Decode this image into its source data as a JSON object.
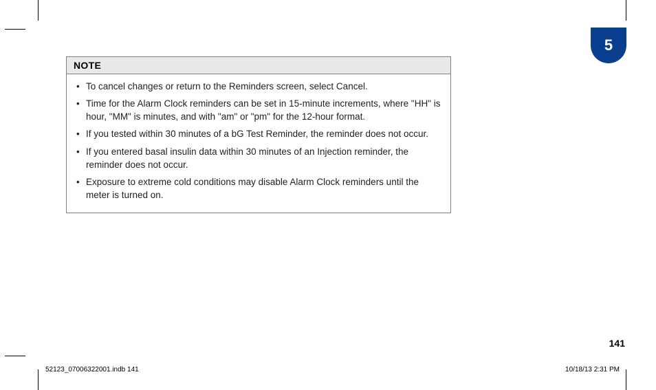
{
  "chapter": {
    "number": "5"
  },
  "note": {
    "heading": "NOTE",
    "items": [
      "To cancel changes or return to the Reminders screen, select Cancel.",
      "Time for the Alarm Clock reminders can be set in 15-minute increments, where \"HH\" is hour, \"MM\" is minutes, and with \"am\" or \"pm\" for the 12-hour format.",
      "If you tested within 30 minutes of a bG Test Reminder, the reminder does not occur.",
      "If you entered basal insulin data within 30 minutes of an Injection reminder, the reminder does not occur.",
      "Exposure to extreme cold conditions may disable Alarm Clock reminders until the meter is turned on."
    ]
  },
  "footer": {
    "page_number": "141",
    "slug_left": "52123_07006322001.indb   141",
    "slug_right": "10/18/13   2:31 PM"
  }
}
